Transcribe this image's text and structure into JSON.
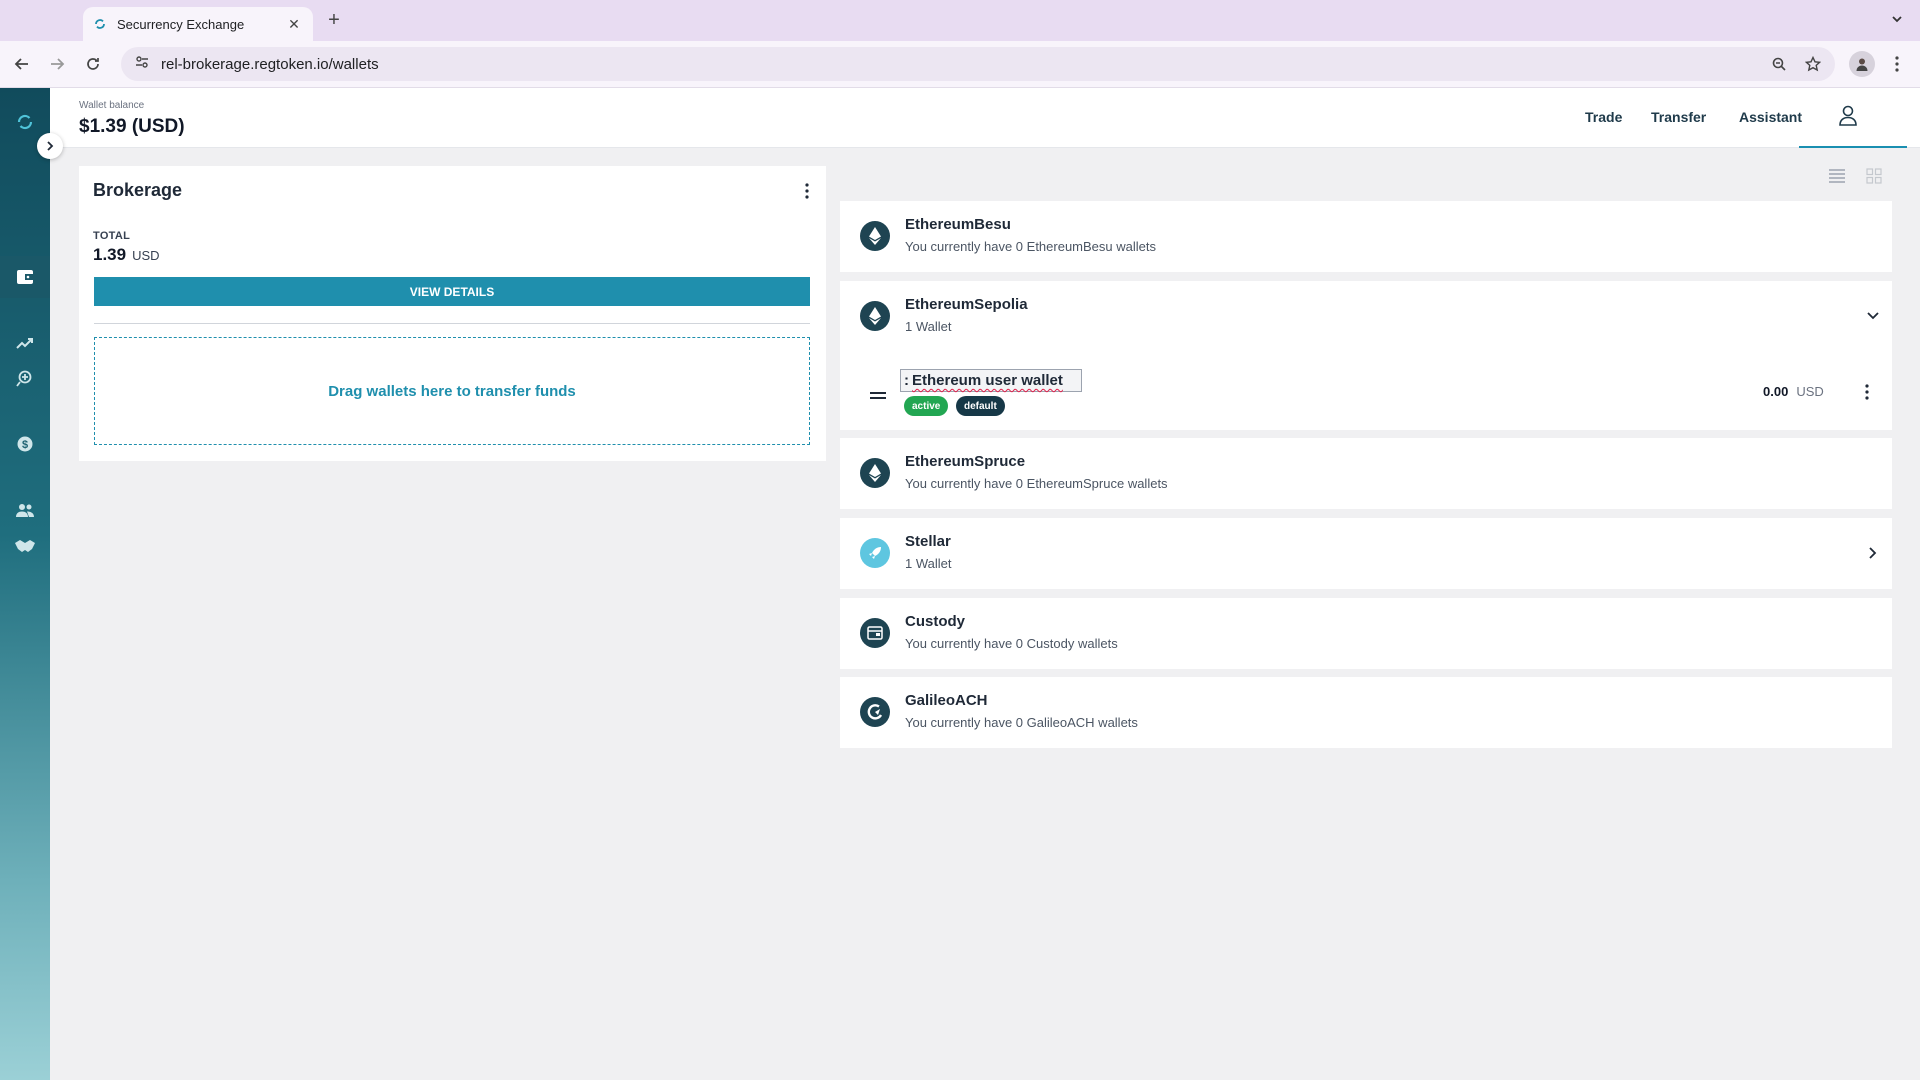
{
  "browser": {
    "tab_title": "Securrency Exchange",
    "tab_close": "✕",
    "new_tab": "+",
    "url": "rel-brokerage.regtoken.io/wallets"
  },
  "header": {
    "balance_label": "Wallet balance",
    "balance_value": "$1.39 (USD)",
    "nav": {
      "trade": "Trade",
      "transfer": "Transfer",
      "assistant": "Assistant"
    }
  },
  "brokerage": {
    "title": "Brokerage",
    "total_label": "TOTAL",
    "total_value": "1.39",
    "total_unit": "USD",
    "view_details": "VIEW DETAILS",
    "drop_text": "Drag wallets here to transfer funds"
  },
  "networks": [
    {
      "name": "EthereumBesu",
      "subtitle": "You currently have 0 EthereumBesu wallets",
      "icon": "ethereum-icon"
    },
    {
      "name": "EthereumSepolia",
      "subtitle": "1 Wallet",
      "icon": "ethereum-icon",
      "expanded": true,
      "wallet": {
        "name": "Ethereum user wallet",
        "prefix": ":",
        "status": "active",
        "tag": "default",
        "amount": "0.00",
        "unit": "USD"
      }
    },
    {
      "name": "EthereumSpruce",
      "subtitle": "You currently have 0 EthereumSpruce wallets",
      "icon": "ethereum-icon"
    },
    {
      "name": "Stellar",
      "subtitle": "1 Wallet",
      "icon": "stellar-rocket-icon"
    },
    {
      "name": "Custody",
      "subtitle": "You currently have 0 Custody wallets",
      "icon": "custody-icon"
    },
    {
      "name": "GalileoACH",
      "subtitle": "You currently have 0 GalileoACH wallets",
      "icon": "galileo-icon"
    }
  ],
  "colors": {
    "accent": "#1f8fad",
    "active_badge": "#22a652",
    "default_badge": "#163847",
    "sidebar_top": "#114b5c",
    "icon_dark": "#1e4452",
    "stellar": "#5ec6e0"
  }
}
